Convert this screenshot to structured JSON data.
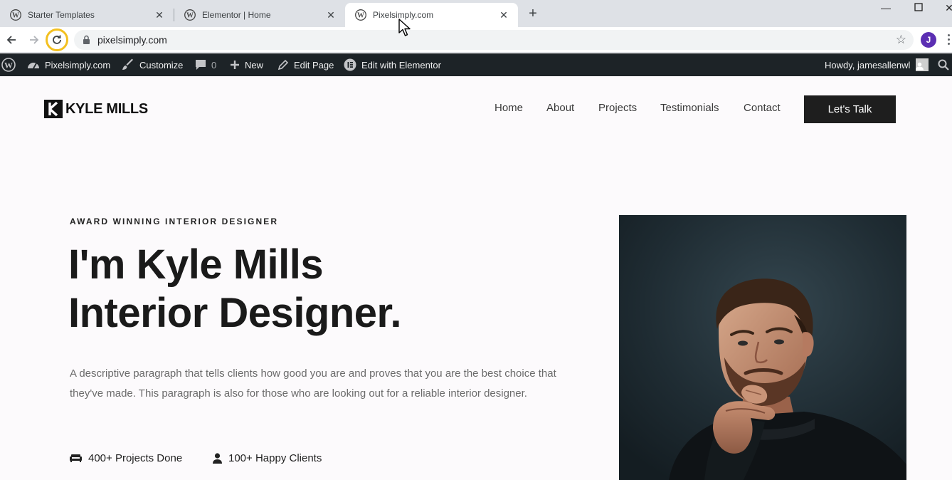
{
  "browser": {
    "tabs": [
      {
        "title": "Starter Templates",
        "active": false
      },
      {
        "title": "Elementor | Home",
        "active": false
      },
      {
        "title": "Pixelsimply.com",
        "active": true
      }
    ],
    "url": "pixelsimply.com",
    "profile_initial": "J",
    "icons": {
      "back": "arrow-left-icon",
      "forward": "arrow-right-icon",
      "reload": "reload-icon",
      "lock": "lock-icon",
      "bookmark": "star-icon"
    }
  },
  "admin_bar": {
    "site_name": "Pixelsimply.com",
    "customize": "Customize",
    "comments_count": "0",
    "new": "New",
    "edit_page": "Edit Page",
    "edit_with_elementor": "Edit with Elementor",
    "howdy": "Howdy, jamesallenwl",
    "colors": {
      "background": "#1d2327",
      "text": "#f0f0f1"
    }
  },
  "site": {
    "logo_text": "KYLE MILLS",
    "nav": [
      "Home",
      "About",
      "Projects",
      "Testimonials",
      "Contact"
    ],
    "cta_label": "Let's Talk",
    "colors": {
      "cta_background": "#1e1e1e",
      "page_background": "#fcfafc"
    }
  },
  "hero": {
    "eyebrow": "AWARD WINNING INTERIOR DESIGNER",
    "headline_line1": "I'm Kyle Mills",
    "headline_line2": "Interior Designer.",
    "paragraph": "A descriptive paragraph that tells clients how good you are and proves that you are the best choice that they've made. This paragraph is also for those who are looking out for a reliable interior designer.",
    "stats": [
      {
        "icon": "sofa-icon",
        "label": "400+ Projects Done"
      },
      {
        "icon": "user-icon",
        "label": "100+ Happy Clients"
      }
    ]
  }
}
